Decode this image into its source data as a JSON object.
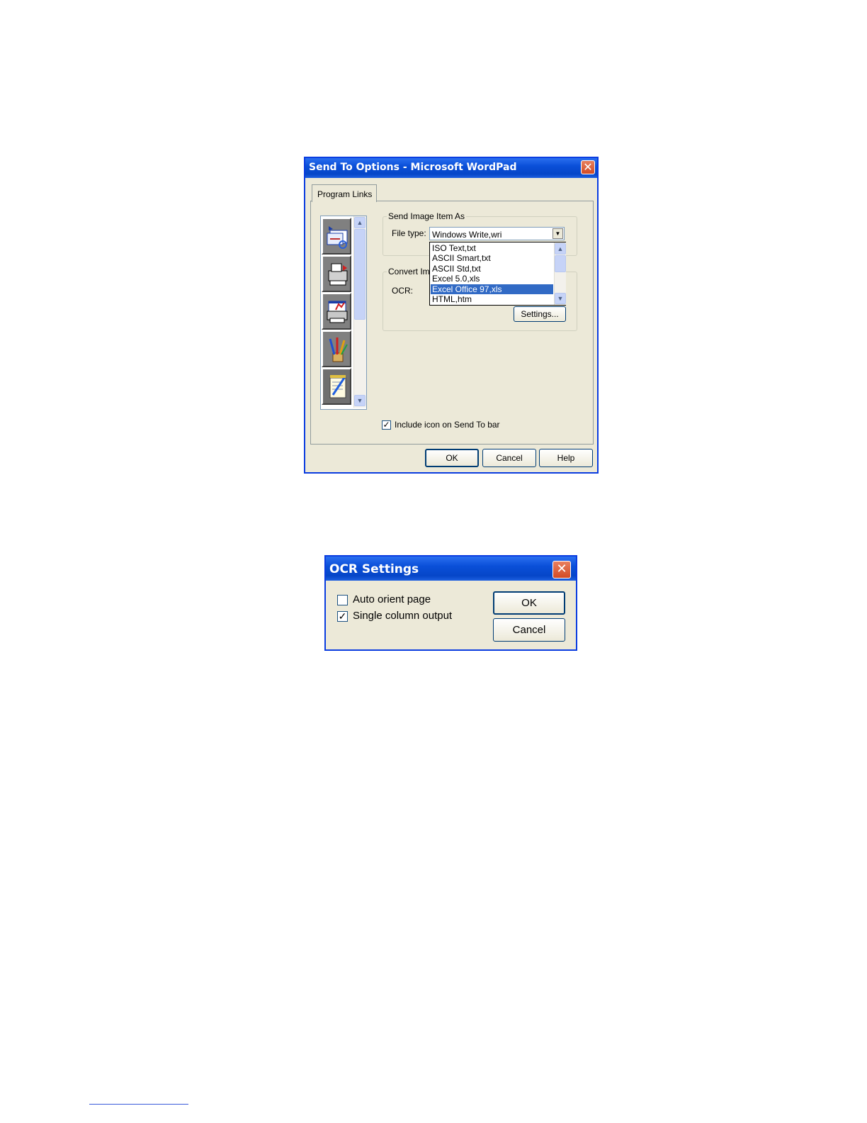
{
  "sendto": {
    "title": "Send To Options - Microsoft WordPad",
    "close_glyph": "✕",
    "tab_label": "Program Links",
    "icons": [
      "mail-icon",
      "fax-icon",
      "print-icon",
      "paint-icon",
      "wordpad-icon"
    ],
    "group1_legend": "Send Image Item As",
    "filetype_label": "File type:",
    "filetype_value": "Windows Write,wri",
    "dropdown_items": [
      "ISO Text,txt",
      "ASCII Smart,txt",
      "ASCII Std,txt",
      "Excel 5.0,xls",
      "Excel Office 97,xls",
      "HTML,htm"
    ],
    "dropdown_selected": "Excel Office 97,xls",
    "group2_legend": "Convert Ima",
    "ocr_label": "OCR:",
    "settings_button": "Settings...",
    "include_icon_label": "Include icon on Send To bar",
    "include_icon_checked": true,
    "ok_button": "OK",
    "cancel_button": "Cancel",
    "help_button": "Help"
  },
  "ocr": {
    "title": "OCR Settings",
    "close_glyph": "✕",
    "auto_orient_label": "Auto orient page",
    "auto_orient_checked": false,
    "single_column_label": "Single column output",
    "single_column_checked": true,
    "ok_button": "OK",
    "cancel_button": "Cancel"
  }
}
